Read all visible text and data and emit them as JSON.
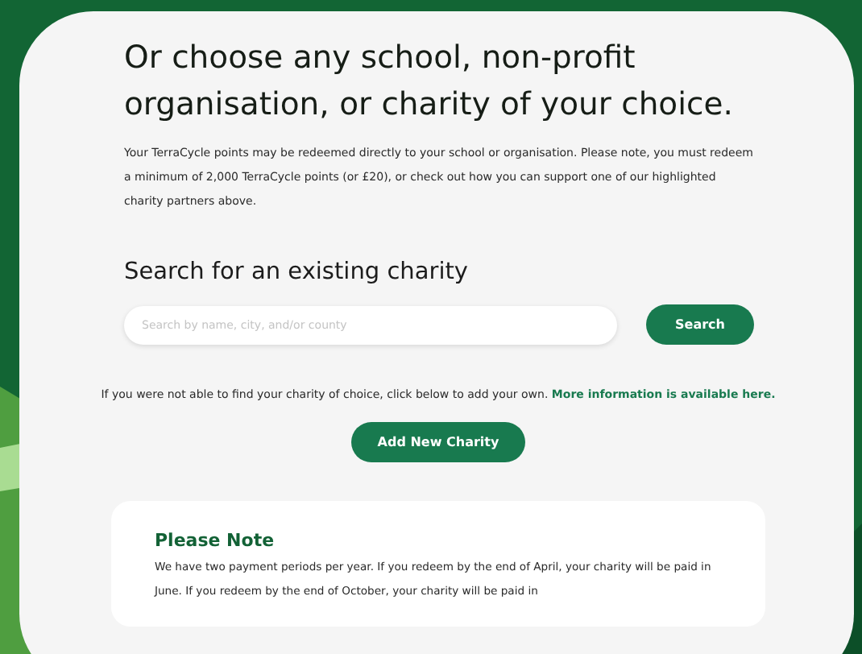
{
  "heading": "Or choose any school, non-profit organisation, or charity of your choice.",
  "intro": "Your TerraCycle points may be redeemed directly to your school or organisation. Please note, you must redeem a minimum of 2,000 TerraCycle points (or £20), or check out how you can support one of our highlighted charity partners above.",
  "search": {
    "title": "Search for an existing charity",
    "placeholder": "Search by name, city, and/or county",
    "button": "Search"
  },
  "help": {
    "text": "If you were not able to find your charity of choice, click below to add your own.",
    "link": "More information is available here."
  },
  "add_button": "Add New Charity",
  "note": {
    "title": "Please Note",
    "text": "We have two payment periods per year. If you redeem by the end of April, your charity will be paid in June. If you redeem by the end of October, your charity will be paid in"
  }
}
